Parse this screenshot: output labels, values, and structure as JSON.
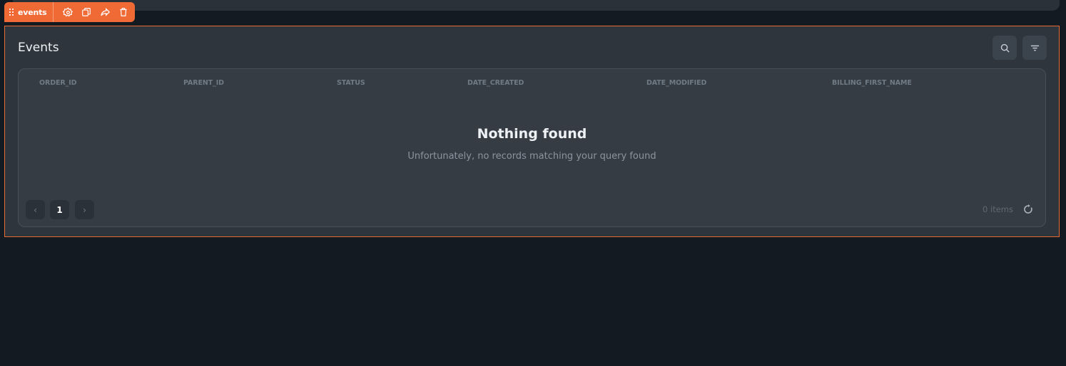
{
  "toolbar": {
    "widget_name": "events",
    "icons": [
      "settings-icon",
      "duplicate-icon",
      "share-icon",
      "delete-icon"
    ]
  },
  "widget": {
    "title": "Events",
    "actions": [
      "search-icon",
      "filter-icon"
    ]
  },
  "table": {
    "columns": [
      "ORDER_ID",
      "PARENT_ID",
      "STATUS",
      "DATE_CREATED",
      "DATE_MODIFIED",
      "BILLING_FIRST_NAME"
    ],
    "empty_title": "Nothing found",
    "empty_message": "Unfortunately, no records matching your query found"
  },
  "pagination": {
    "prev": "‹",
    "current_page": "1",
    "next": "›",
    "items_count": "0 items"
  },
  "colors": {
    "accent": "#f06a35",
    "background": "#141a21",
    "panel": "#2e353d"
  }
}
